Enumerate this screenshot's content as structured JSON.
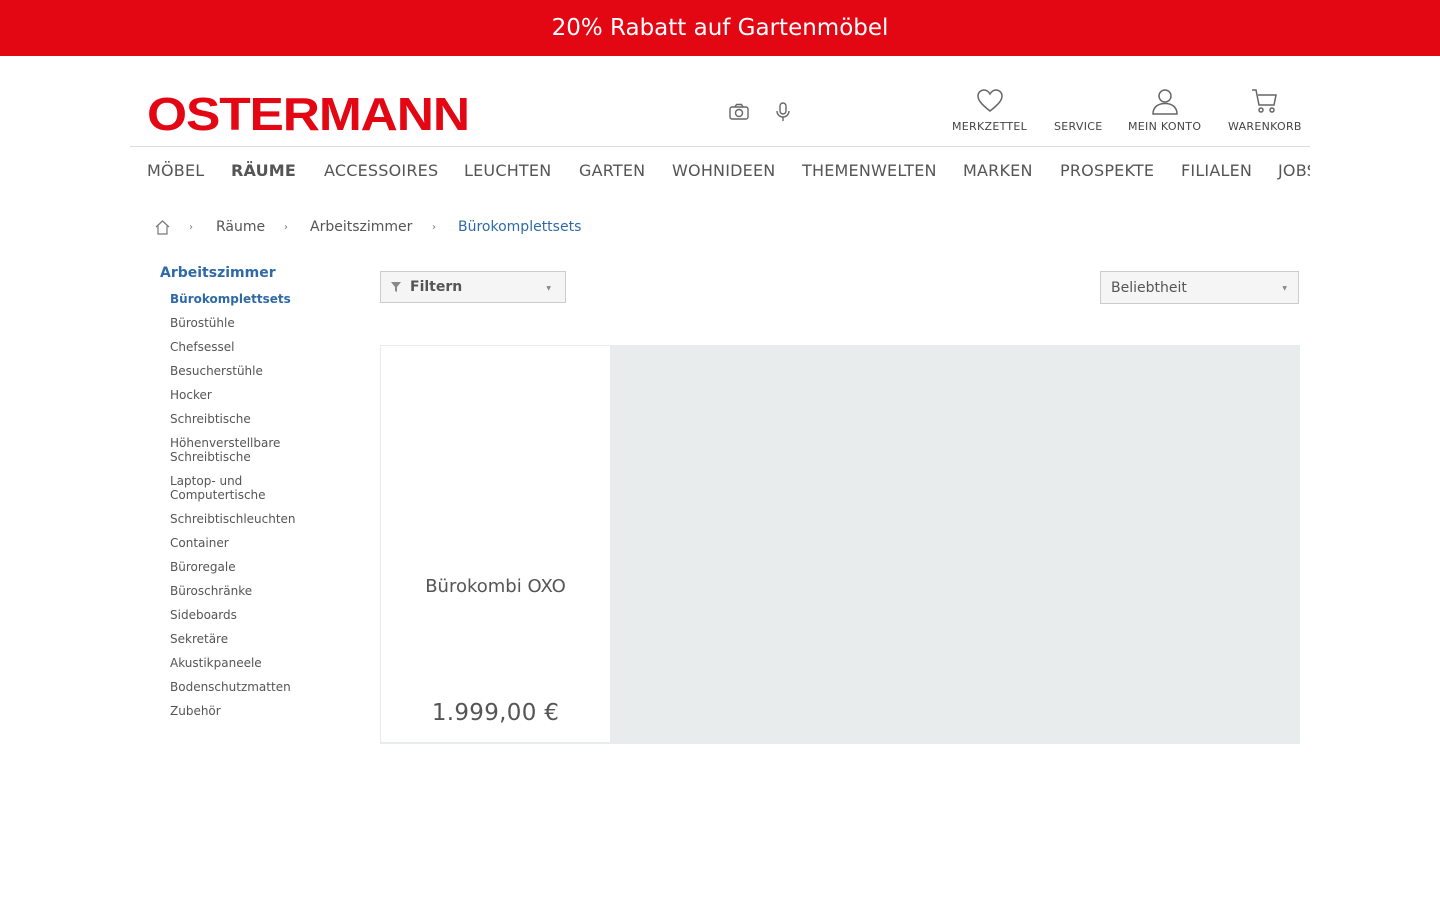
{
  "promo": {
    "text": "20% Rabatt auf Gartenmöbel"
  },
  "header": {
    "logo": "OSTERMANN",
    "tools": {
      "camera": "camera-icon",
      "mic": "microphone-icon"
    },
    "actions": [
      {
        "label": "MERKZETTEL",
        "icon": "heart-icon"
      },
      {
        "label": "SERVICE"
      },
      {
        "label": "MEIN KONTO",
        "icon": "user-icon"
      },
      {
        "label": "WARENKORB",
        "icon": "cart-icon"
      }
    ]
  },
  "nav": {
    "items": [
      "MÖBEL",
      "RÄUME",
      "ACCESSOIRES",
      "LEUCHTEN",
      "GARTEN",
      "WOHNIDEEN",
      "THEMENWELTEN",
      "MARKEN",
      "PROSPEKTE",
      "FILIALEN",
      "JOBS"
    ],
    "active": "RÄUME"
  },
  "breadcrumb": {
    "home_icon": "home-icon",
    "items": [
      "Räume",
      "Arbeitszimmer",
      "Bürokomplettsets"
    ]
  },
  "sidebar": {
    "title": "Arbeitszimmer",
    "items": [
      "Bürokomplettsets",
      "Bürostühle",
      "Chefsessel",
      "Besucherstühle",
      "Hocker",
      "Schreibtische",
      "Höhenverstellbare Schreibtische",
      "Laptop- und Computertische",
      "Schreibtischleuchten",
      "Container",
      "Büroregale",
      "Büroschränke",
      "Sideboards",
      "Sekretäre",
      "Akustikpaneele",
      "Bodenschutzmatten",
      "Zubehör"
    ],
    "active": "Bürokomplettsets"
  },
  "toolbar": {
    "filter_label": "Filtern",
    "sort_value": "Beliebtheit"
  },
  "products": [
    {
      "name": "Bürokombi OXO",
      "price": "1.999,00 €"
    }
  ],
  "colors": {
    "brand_red": "#e30613",
    "link_blue": "#2f6aa7"
  }
}
